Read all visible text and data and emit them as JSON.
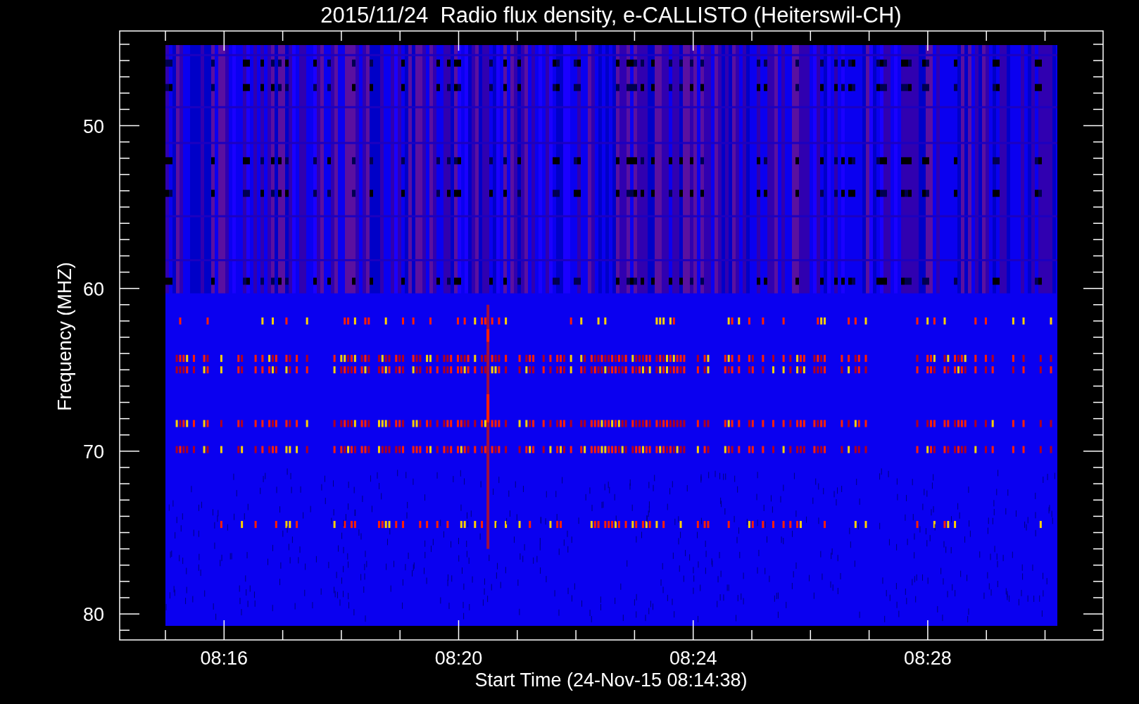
{
  "title": "2015/11/24  Radio flux density, e-CALLISTO (Heiterswil-CH)",
  "y_axis": {
    "label": "Frequency (MHZ)",
    "ticks": [
      "50",
      "60",
      "70",
      "80"
    ]
  },
  "x_axis": {
    "label": "Start Time (24-Nov-15 08:14:38)",
    "ticks": [
      "08:16",
      "08:20",
      "08:24",
      "08:28"
    ]
  }
}
